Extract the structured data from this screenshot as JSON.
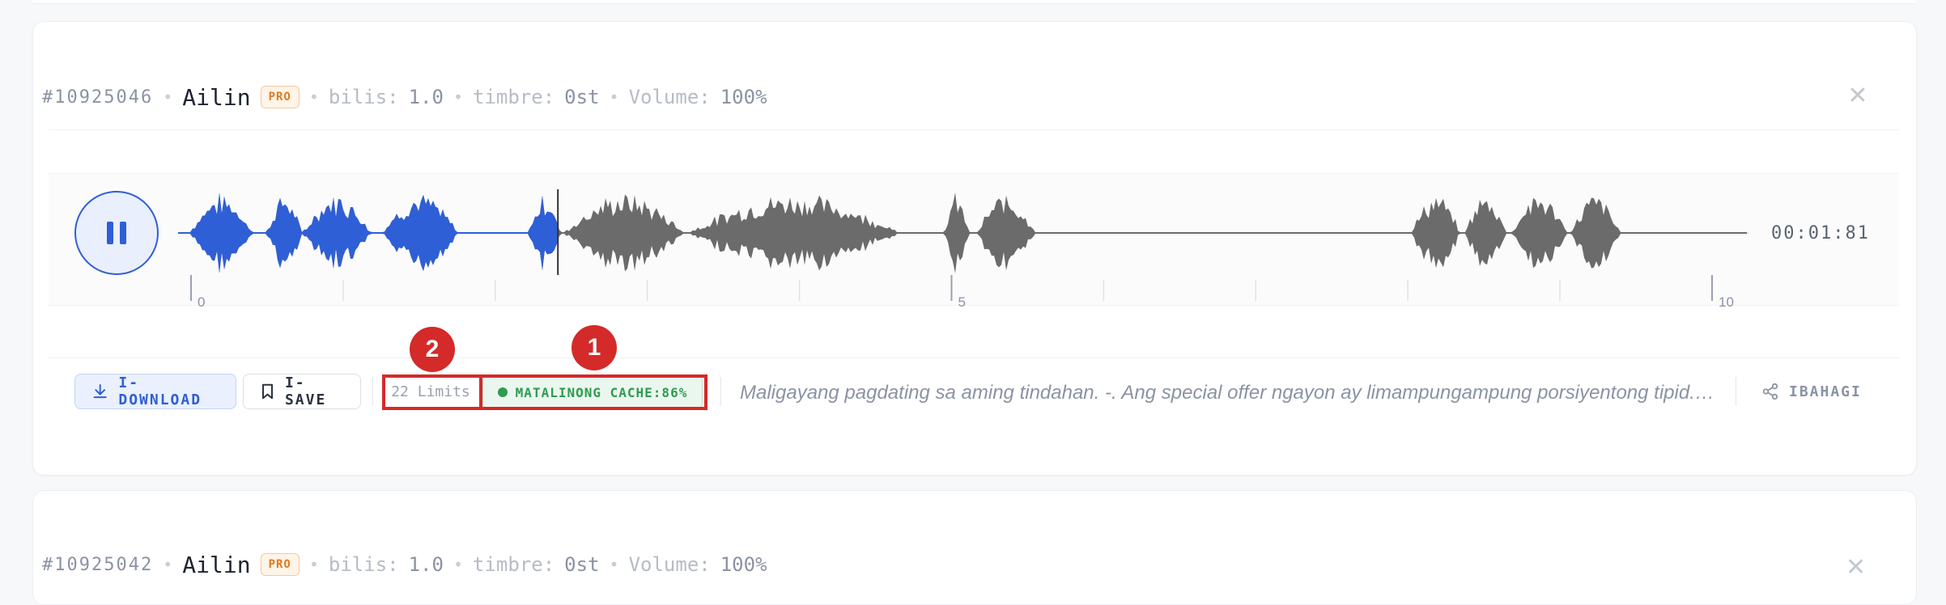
{
  "record1": {
    "id": "#10925046",
    "voice_name": "Ailin",
    "badge": "PRO",
    "speed_label": "bilis:",
    "speed_value": "1.0",
    "timbre_label": "timbre:",
    "timbre_value": "0st",
    "volume_label": "Volume:",
    "volume_value": "100%",
    "duration": "00:01:81",
    "timeline_ticks": [
      "0",
      "5",
      "10"
    ],
    "playback_progress": 0.18,
    "buttons": {
      "download": "I-DOWNLOAD",
      "save": "I-SAVE",
      "share": "IBAHAGI"
    },
    "limits": "22 Limits",
    "cache": "MATALINONG CACHE:86%",
    "text_snippet": "Maligayang pagdating sa aming tindahan. -. Ang special offer ngayon ay limampungampung porsiyentong tipid.<b..."
  },
  "record2": {
    "id": "#10925042",
    "voice_name": "Ailin",
    "badge": "PRO",
    "speed_label": "bilis:",
    "speed_value": "1.0",
    "timbre_label": "timbre:",
    "timbre_value": "0st",
    "volume_label": "Volume:",
    "volume_value": "100%"
  },
  "annotations": [
    "1",
    "2"
  ],
  "colors": {
    "accent": "#2f5fd6",
    "waveform_played": "#2f5fd6",
    "waveform_unplayed": "#6b6b6b",
    "cache_green": "#2f9b50",
    "pro_orange": "#e07a20",
    "annotation_red": "#d42a2a"
  }
}
